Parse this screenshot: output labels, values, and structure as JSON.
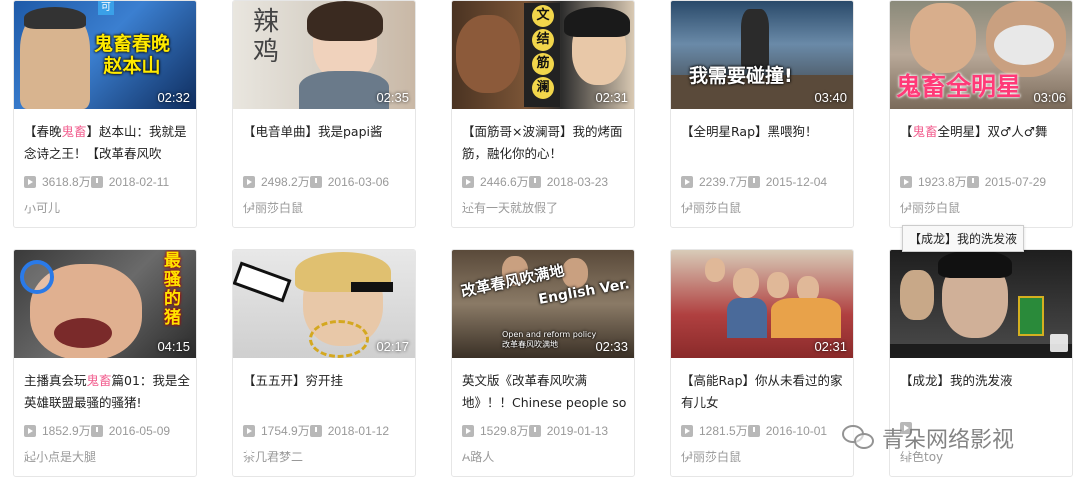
{
  "videos": [
    {
      "title_pre": "【春晚",
      "title_hl": "鬼畜",
      "title_post": "】赵本山：我就是念诗之王！【改革春风吹",
      "duration": "02:32",
      "views": "3618.8万",
      "date": "2018-02-11",
      "author": "小可儿",
      "overlay": "鬼畜春晚\n赵本山"
    },
    {
      "title_pre": "【电音单曲】我是papi酱",
      "title_hl": "",
      "title_post": "",
      "duration": "02:35",
      "views": "2498.2万",
      "date": "2016-03-06",
      "author": "伊丽莎白鼠",
      "overlay": "辣\n鸡"
    },
    {
      "title_pre": "【面筋哥×波澜哥】我的烤面筋，融化你的心！",
      "title_hl": "",
      "title_post": "",
      "duration": "02:31",
      "views": "2446.6万",
      "date": "2018-03-23",
      "author": "还有一天就放假了",
      "overlay": "文\n结\n筋\n澜"
    },
    {
      "title_pre": "【全明星Rap】黑喂狗！",
      "title_hl": "",
      "title_post": "",
      "duration": "03:40",
      "views": "2239.7万",
      "date": "2015-12-04",
      "author": "伊丽莎白鼠",
      "overlay": "我需要碰撞！"
    },
    {
      "title_pre": "【",
      "title_hl": "鬼畜",
      "title_post": "全明星】双♂人♂舞",
      "duration": "03:06",
      "views": "1923.8万",
      "date": "2015-07-29",
      "author": "伊丽莎白鼠",
      "overlay": "鬼畜全明星"
    },
    {
      "title_pre": "主播真会玩",
      "title_hl": "鬼畜",
      "title_post": "篇01：我是全英雄联盟最骚的骚猪!",
      "duration": "04:15",
      "views": "1852.9万",
      "date": "2016-05-09",
      "author": "起小点是大腿",
      "overlay": "最骚的猪"
    },
    {
      "title_pre": "【五五开】穷开挂",
      "title_hl": "",
      "title_post": "",
      "duration": "02:17",
      "views": "1754.9万",
      "date": "2018-01-12",
      "author": "茶几君梦二",
      "overlay": ""
    },
    {
      "title_pre": "英文版《改革春风吹满地》！！Chinese people so",
      "title_hl": "",
      "title_post": "",
      "duration": "02:33",
      "views": "1529.8万",
      "date": "2019-01-13",
      "author": "A路人",
      "overlay": "改革春风吹满地\nEnglish Ver."
    },
    {
      "title_pre": "【高能Rap】你从未看过的家有儿女",
      "title_hl": "",
      "title_post": "",
      "duration": "02:31",
      "views": "1281.5万",
      "date": "2016-10-01",
      "author": "伊丽莎白鼠",
      "overlay": ""
    },
    {
      "title_pre": "【成龙】我的洗发液",
      "title_hl": "",
      "title_post": "",
      "duration": "",
      "views": "",
      "date": "",
      "author": "绯色toy",
      "overlay": ""
    }
  ],
  "tooltip": "【成龙】我的洗发液",
  "watermark": "青朵网络影视",
  "colors": {
    "highlight": "#f25d8e",
    "meta": "#999999",
    "border": "#e6e6e6"
  }
}
